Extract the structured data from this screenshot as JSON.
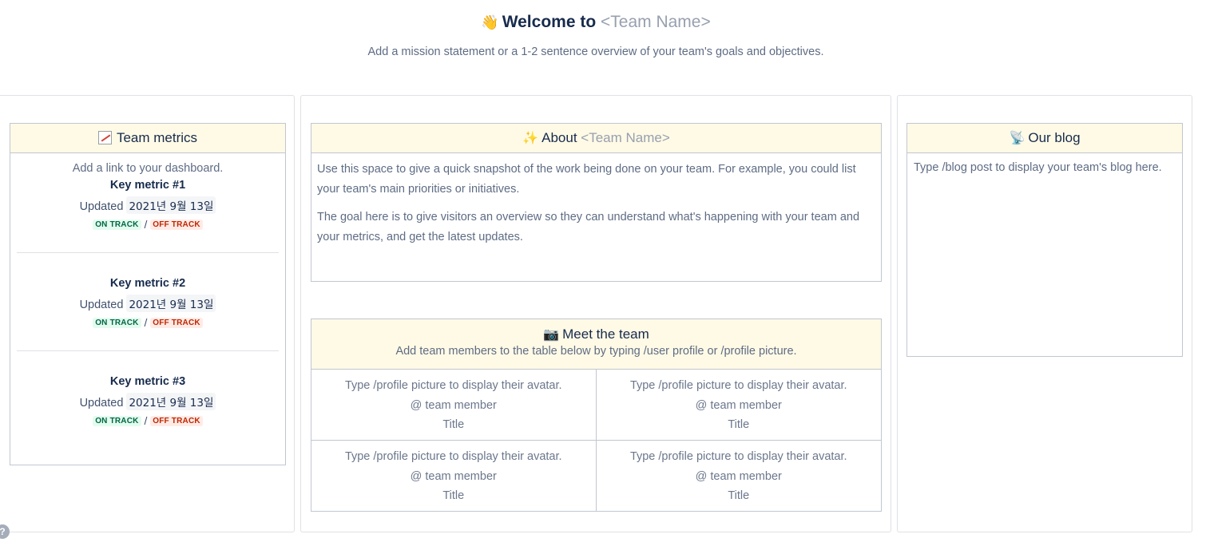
{
  "header": {
    "wave_icon": "👋",
    "title_prefix": "Welcome to",
    "title_placeholder": "<Team Name>",
    "subtitle": "Add a mission statement or a 1-2 sentence overview of your team's goals and objectives."
  },
  "metrics": {
    "icon": "chart-increasing-icon",
    "heading": "Team metrics",
    "intro": "Add a link to your dashboard.",
    "items": [
      {
        "name": "Key metric #1",
        "updated_label": "Updated",
        "date": "2021년 9월 13일",
        "on_track": "ON TRACK",
        "separator": "/",
        "off_track": "OFF TRACK"
      },
      {
        "name": "Key metric #2",
        "updated_label": "Updated",
        "date": "2021년 9월 13일",
        "on_track": "ON TRACK",
        "separator": "/",
        "off_track": "OFF TRACK"
      },
      {
        "name": "Key metric #3",
        "updated_label": "Updated",
        "date": "2021년 9월 13일",
        "on_track": "ON TRACK",
        "separator": "/",
        "off_track": "OFF TRACK"
      }
    ]
  },
  "about": {
    "icon": "✨",
    "heading": "About",
    "placeholder": "<Team Name>",
    "para1": "Use this space to give a quick snapshot of the work being done on your team. For example, you could list your team's main priorities or initiatives.",
    "para2": "The goal here is to give visitors an overview so they can understand what's happening with your team and your metrics, and get the latest updates."
  },
  "team": {
    "icon": "📷",
    "heading": "Meet the team",
    "subtitle": "Add team members to the table below by typing /user profile or /profile picture.",
    "cells": [
      {
        "avatar": "Type /profile picture to display their avatar.",
        "member": "@ team member",
        "title": "Title"
      },
      {
        "avatar": "Type /profile picture to display their avatar.",
        "member": "@ team member",
        "title": "Title"
      },
      {
        "avatar": "Type /profile picture to display their avatar.",
        "member": "@ team member",
        "title": "Title"
      },
      {
        "avatar": "Type /profile picture to display their avatar.",
        "member": "@ team member",
        "title": "Title"
      }
    ]
  },
  "blog": {
    "icon": "📡",
    "heading": "Our blog",
    "text": "Type /blog post to display your team's blog here."
  },
  "help": {
    "label": "?"
  },
  "colors": {
    "header_bg": "#fffae6",
    "on_track": "#006644",
    "off_track": "#bf2600"
  }
}
